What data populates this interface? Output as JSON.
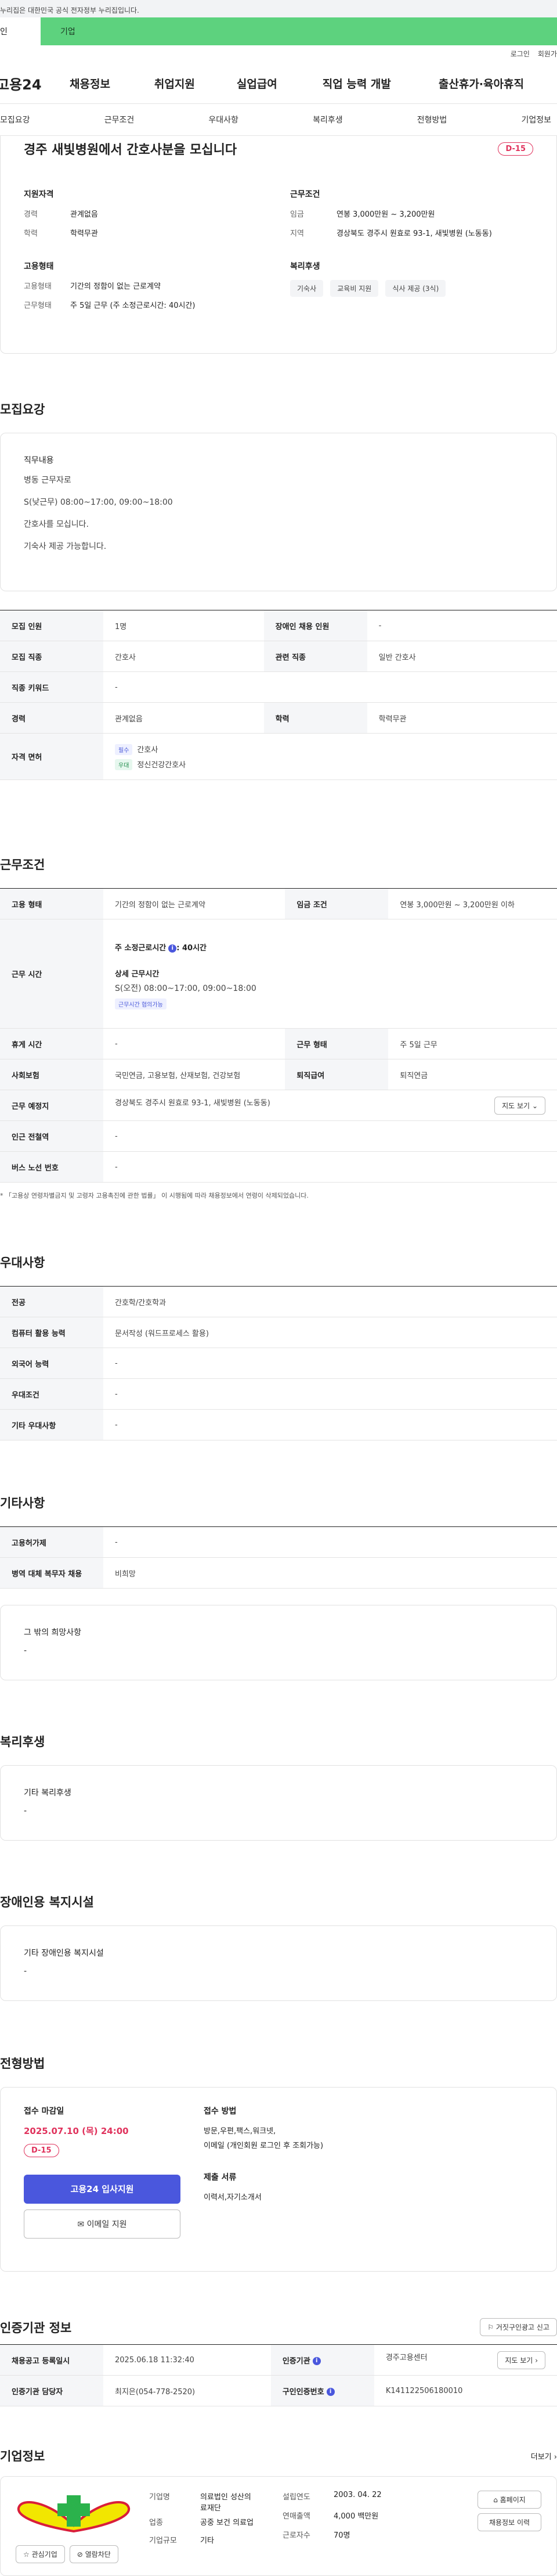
{
  "gov_banner": "누리집은 대한민국 공식 전자정부 누리집입니다.",
  "user_tabs": [
    "인",
    "기업"
  ],
  "util_links": [
    "로그인",
    "회원가"
  ],
  "logo": "고용24",
  "gnb": [
    "채용정보",
    "취업지원",
    "실업급여",
    "직업 능력 개발",
    "출산휴가·육아휴직"
  ],
  "snb": [
    "모집요강",
    "근무조건",
    "우대사항",
    "복리후생",
    "전형방법",
    "기업정보"
  ],
  "summary": {
    "title": "경주 새빛병원에서 간호사분을 모십니다",
    "dday": "D-15",
    "qual": {
      "heading": "지원자격",
      "rows": [
        {
          "k": "경력",
          "v": "관계없음"
        },
        {
          "k": "학력",
          "v": "학력무관"
        }
      ]
    },
    "cond": {
      "heading": "근무조건",
      "rows": [
        {
          "k": "임금",
          "v": "연봉 3,000만원 ~ 3,200만원"
        },
        {
          "k": "지역",
          "v": "경상북도 경주시 원효로 93-1, 새빛병원 (노동동)"
        }
      ]
    },
    "emp": {
      "heading": "고용형태",
      "rows": [
        {
          "k": "고용형태",
          "v": "기간의 정함이 없는 근로계약"
        },
        {
          "k": "근무형태",
          "v": "주 5일 근무 (주 소정근로시간: 40시간)"
        }
      ]
    },
    "welfare": {
      "heading": "복리후생",
      "chips": [
        "기숙사",
        "교육비 지원",
        "식사 제공 (3식)"
      ]
    }
  },
  "recruit": {
    "title": "모집요강",
    "job_heading": "직무내용",
    "job_lines": [
      "병동 근무자로",
      "S(낮근무) 08:00~17:00, 09:00~18:00",
      "간호사를 모십니다.",
      "기숙사 제공 가능합니다."
    ],
    "table": [
      {
        "h1": "모집 인원",
        "v1": "1명",
        "h2": "장애인 채용 인원",
        "v2": "-"
      },
      {
        "h1": "모집 직종",
        "v1": "간호사",
        "h2": "관련 직종",
        "v2": "일반 간호사"
      },
      {
        "h1": "직종 키워드",
        "v1": "-"
      },
      {
        "h1": "경력",
        "v1": "관계없음",
        "h2": "학력",
        "v2": "학력무관"
      }
    ],
    "license_h": "자격 면허",
    "licenses": [
      {
        "tag": "필수",
        "name": "간호사"
      },
      {
        "tag": "우대",
        "name": "정신건강간호사"
      }
    ]
  },
  "work": {
    "title": "근무조건",
    "emp_h": "고용 형태",
    "emp_v": "기간의 정함이 없는 근로계약",
    "wage_h": "임금 조건",
    "wage_v": "연봉 3,000만원 ~ 3,200만원 이하",
    "hours_h": "근무 시간",
    "hours_weekly_label": "주 소정근로시간",
    "hours_weekly_value": ": 40시간",
    "hours_detail_label": "상세 근무시간",
    "hours_detail": "S(오전) 08:00~17:00, 09:00~18:00",
    "hours_badge": "근무시간 협의가능",
    "rest_h": "휴게 시간",
    "rest_v": "-",
    "type_h": "근무 형태",
    "type_v": "주 5일 근무",
    "ins_h": "사회보험",
    "ins_v": "국민연금, 고용보험, 산재보험, 건강보험",
    "ret_h": "퇴직급여",
    "ret_v": "퇴직연금",
    "place_h": "근무 예정지",
    "place_v": "경상북도 경주시 원효로 93-1, 새빛병원 (노동동)",
    "map_btn": "지도 보기",
    "station_h": "인근 전철역",
    "station_v": "-",
    "bus_h": "버스 노선 번호",
    "bus_v": "-",
    "note": "「고용상 연령차별금지 및 고령자 고용촉진에 관한 법률」 이 시행됨에 따라 채용정보에서 연령이 삭제되었습니다."
  },
  "pref": {
    "title": "우대사항",
    "rows": [
      {
        "h": "전공",
        "v": "간호학/간호학과"
      },
      {
        "h": "컴퓨터 활용 능력",
        "v": "문서작성 (워드프로세스 활용)"
      },
      {
        "h": "외국어 능력",
        "v": "-"
      },
      {
        "h": "우대조건",
        "v": "-"
      },
      {
        "h": "기타 우대사항",
        "v": "-"
      }
    ]
  },
  "etc": {
    "title": "기타사항",
    "rows": [
      {
        "h": "고용허가제",
        "v": "-"
      },
      {
        "h": "병역 대체 복무자 채용",
        "v": "비희망"
      }
    ],
    "other_h": "그 밖의 희망사항",
    "other_v": "-"
  },
  "welfare": {
    "title": "복리후생",
    "h": "기타 복리후생",
    "v": "-"
  },
  "disab": {
    "title": "장애인용 복지시설",
    "h": "기타 장애인용 복지시설",
    "v": "-"
  },
  "process": {
    "title": "전형방법",
    "deadline_h": "접수 마감일",
    "deadline_v": "2025.07.10 (목) 24:00",
    "dday": "D-15",
    "apply_btn": "고용24 입사지원",
    "email_btn": "이메일 지원",
    "method_h": "접수 방법",
    "method_v1": "방문,우편,팩스,워크넷,",
    "method_v2": "이메일 (개인회원 로그인 후 조회가능)",
    "docs_h": "제출 서류",
    "docs_v": "이력서,자기소개서"
  },
  "agency": {
    "title": "인증기관 정보",
    "fraud_btn": "거짓구인광고 신고",
    "rows": [
      {
        "h1": "채용공고 등록일시",
        "v1": "2025.06.18 11:32:40",
        "h2": "인증기관",
        "v2": "경주고용센터"
      },
      {
        "h1": "인증기관 담당자",
        "v1": "최지은(054-778-2520)",
        "h2": "구인인증번호",
        "v2": "K141122506180010"
      }
    ],
    "map_btn": "지도 보기"
  },
  "company": {
    "title": "기업정보",
    "more": "더보기",
    "fav_btn": "관심기업",
    "block_btn": "열람차단",
    "name_h": "기업명",
    "name_v1": "의료법인 성산의",
    "name_v2": "료재단",
    "industry_h": "업종",
    "industry_v": "공중 보건 의료업",
    "size_h": "기업규모",
    "size_v": "기타",
    "est_h": "설립연도",
    "est_v": "2003. 04. 22",
    "sales_h": "연매출액",
    "sales_v": "4,000 백만원",
    "emp_h": "근로자수",
    "emp_v": "70명",
    "home_btn": "홈페이지",
    "jobs_btn": "채용정보 이력"
  },
  "colors": {
    "accent": "#4a57dd",
    "dday": "#e0325c",
    "topbar": "#5dd27e"
  }
}
